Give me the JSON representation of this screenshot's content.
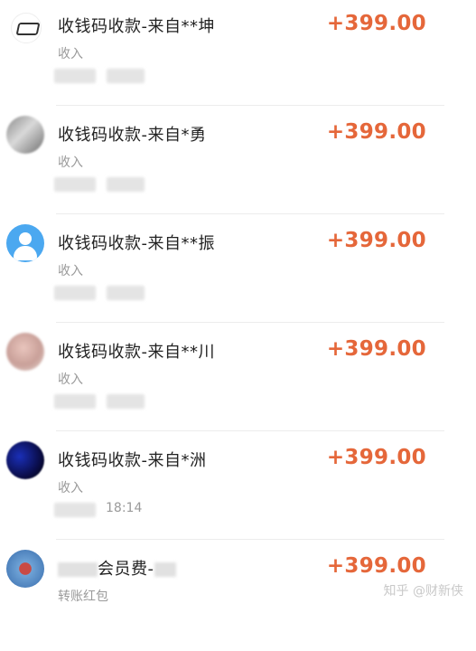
{
  "transactions": [
    {
      "title": "收钱码收款-来自**坤",
      "type": "收入",
      "amount": "+399.00",
      "time": "",
      "avatar": "contact-avatar"
    },
    {
      "title": "收钱码收款-来自*勇",
      "type": "收入",
      "amount": "+399.00",
      "time": "",
      "avatar": "contact-avatar"
    },
    {
      "title": "收钱码收款-来自**振",
      "type": "收入",
      "amount": "+399.00",
      "time": "",
      "avatar": "default-user-icon"
    },
    {
      "title": "收钱码收款-来自**川",
      "type": "收入",
      "amount": "+399.00",
      "time": "",
      "avatar": "contact-avatar"
    },
    {
      "title": "收钱码收款-来自*洲",
      "type": "收入",
      "amount": "+399.00",
      "time": "18:14",
      "avatar": "contact-avatar"
    },
    {
      "title": "会员费-",
      "type": "转账红包",
      "amount": "+399.00",
      "time": "",
      "avatar": "contact-avatar"
    }
  ],
  "watermark": "知乎 @财新侠",
  "colors": {
    "amount": "#e5673a",
    "text": "#222222",
    "muted": "#9a9a9a"
  }
}
